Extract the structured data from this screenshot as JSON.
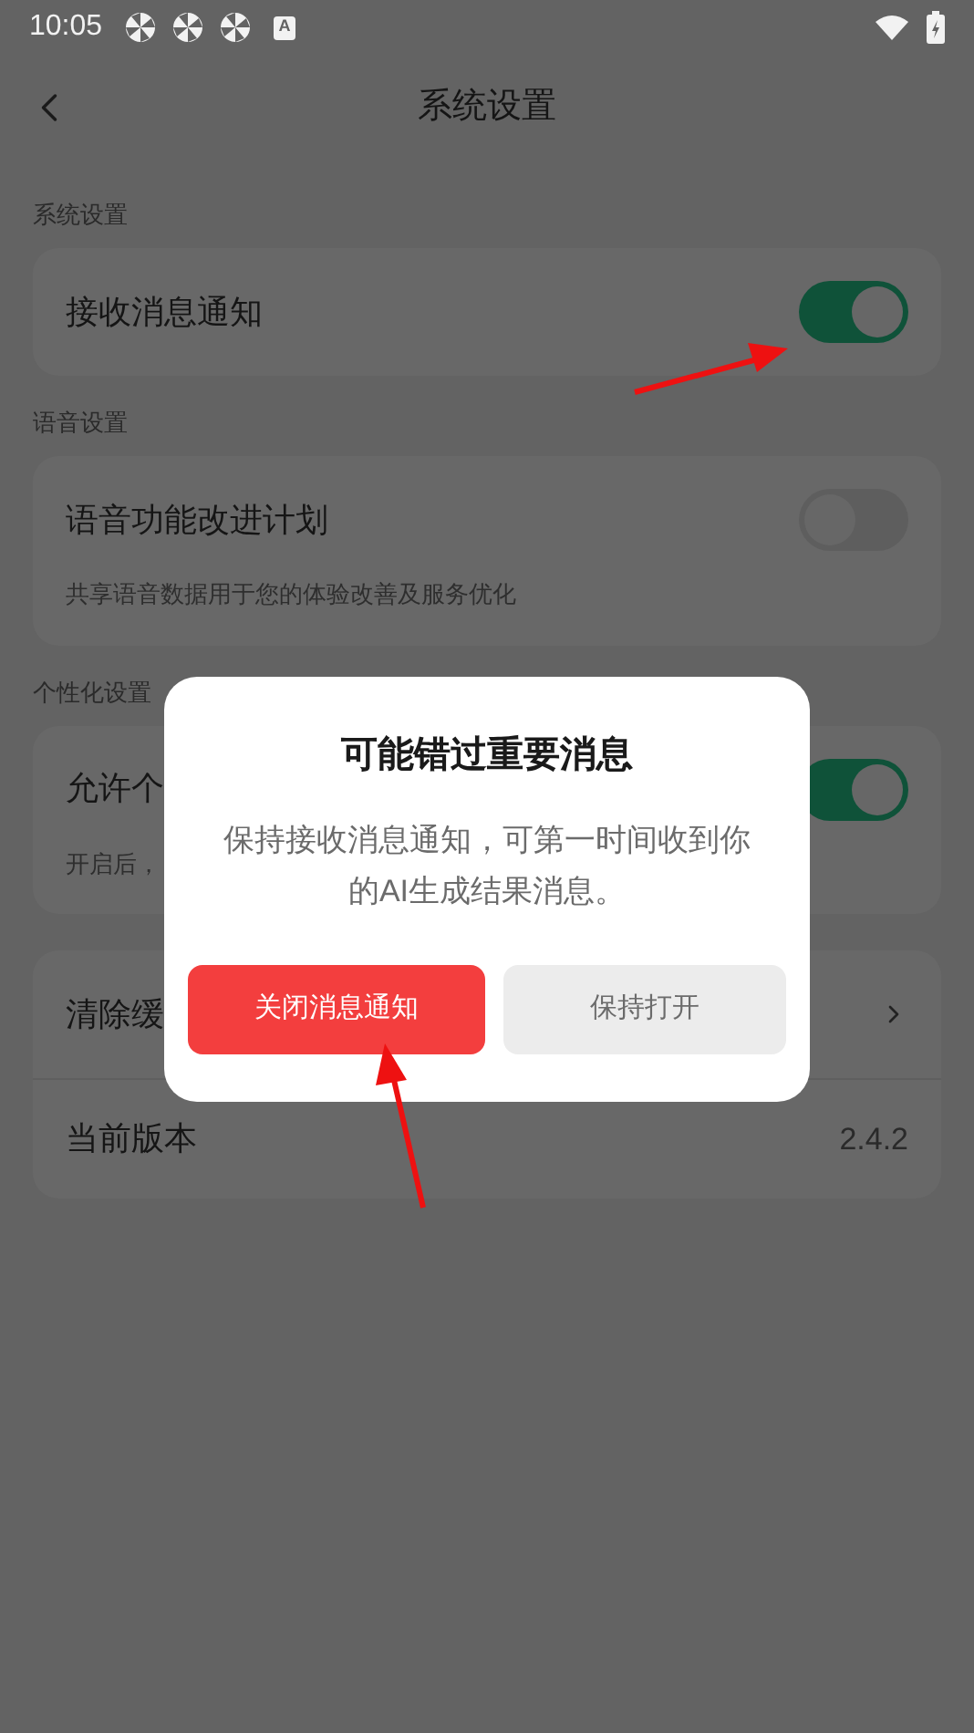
{
  "status_bar": {
    "time": "10:05",
    "input_badge": "A"
  },
  "header": {
    "title": "系统设置"
  },
  "groups": [
    {
      "label": "系统设置",
      "rows": [
        {
          "kind": "toggle",
          "title": "接收消息通知",
          "on": true
        }
      ]
    },
    {
      "label": "语音设置",
      "rows": [
        {
          "kind": "toggle",
          "title": "语音功能改进计划",
          "description": "共享语音数据用于您的体验改善及服务优化",
          "on": false
        }
      ]
    },
    {
      "label": "个性化设置",
      "rows": [
        {
          "kind": "toggle",
          "title": "允许个",
          "description": "开启后，",
          "on": true
        }
      ]
    },
    {
      "rows": [
        {
          "kind": "link",
          "title": "清除缓"
        },
        {
          "kind": "value",
          "title": "当前版本",
          "value": "2.4.2"
        }
      ]
    }
  ],
  "dialog": {
    "title": "可能错过重要消息",
    "message": "保持接收消息通知，可第一时间收到你的AI生成结果消息。",
    "buttons": [
      {
        "label": "关闭消息通知",
        "kind": "primary"
      },
      {
        "label": "保持打开",
        "kind": "secondary"
      }
    ]
  }
}
